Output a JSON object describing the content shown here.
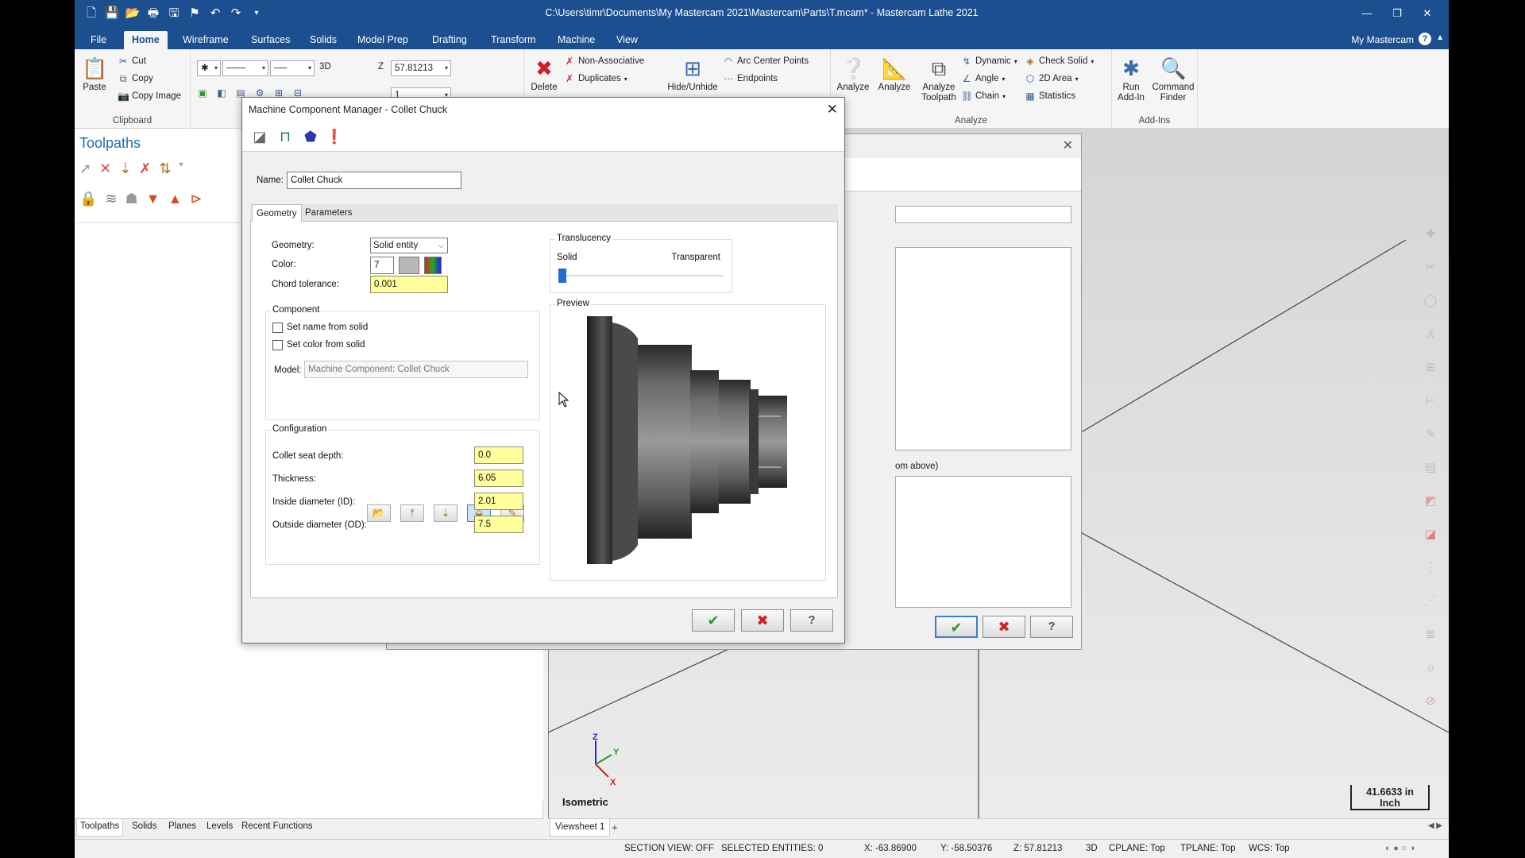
{
  "window": {
    "title": "C:\\Users\\timr\\Documents\\My Mastercam 2021\\Mastercam\\Parts\\T.mcam* - Mastercam Lathe 2021",
    "my_mastercam": "My Mastercam"
  },
  "menu": {
    "tabs": [
      "File",
      "Home",
      "Wireframe",
      "Surfaces",
      "Solids",
      "Model Prep",
      "Drafting",
      "Transform",
      "Machine",
      "View"
    ],
    "active": "Home"
  },
  "ribbon": {
    "clipboard": {
      "paste": "Paste",
      "cut": "Cut",
      "copy": "Copy",
      "copy_image": "Copy Image",
      "label": "Clipboard"
    },
    "attributes": {
      "view_3d": "3D",
      "z_label": "Z",
      "z_value": "57.81213",
      "level_value": "1"
    },
    "organize": {
      "delete": "Delete",
      "non_associative": "Non-Associative",
      "duplicates": "Duplicates",
      "hide_unhide": "Hide/Unhide",
      "arc_center_points": "Arc Center Points",
      "endpoints": "Endpoints"
    },
    "analyze": {
      "analyze1": "Analyze",
      "analyze2": "Analyze",
      "analyze_toolpath_line1": "Analyze",
      "analyze_toolpath_line2": "Toolpath",
      "dynamic": "Dynamic",
      "angle": "Angle",
      "chain": "Chain",
      "check_solid": "Check Solid",
      "area_2d": "2D Area",
      "statistics": "Statistics",
      "label": "Analyze"
    },
    "addins": {
      "run_addin_line1": "Run",
      "run_addin_line2": "Add-In",
      "command_finder_line1": "Command",
      "command_finder_line2": "Finder",
      "label": "Add-Ins"
    }
  },
  "left_panel": {
    "title": "Toolpaths",
    "bottom_tabs": [
      "Toolpaths",
      "Solids",
      "Planes",
      "Levels",
      "Recent Functions"
    ],
    "active_tab": "Toolpaths"
  },
  "viewport": {
    "view_name": "Isometric",
    "scale_value": "41.6633 in",
    "scale_unit": "Inch",
    "sheet_tab": "Viewsheet 1",
    "axis": {
      "z": "Z",
      "y": "Y",
      "x": "X"
    }
  },
  "status_bar": {
    "section_view": "SECTION VIEW: OFF",
    "selected_entities": "SELECTED ENTITIES: 0",
    "x": "X:   -63.86900",
    "y": "Y:   -58.50376",
    "z": "Z:   57.81213",
    "mode": "3D",
    "cplane": "CPLANE: Top",
    "tplane": "TPLANE: Top",
    "wcs": "WCS: Top"
  },
  "background_dialog": {
    "partial_text": "om above)"
  },
  "dialog": {
    "title": "Machine Component Manager - Collet Chuck",
    "name_label": "Name:",
    "name_value": "Collet Chuck",
    "tabs": [
      "Geometry",
      "Parameters"
    ],
    "active_tab": "Geometry",
    "geometry_label": "Geometry:",
    "geometry_value": "Solid entity",
    "color_label": "Color:",
    "color_value": "7",
    "chord_label": "Chord tolerance:",
    "chord_value": "0.001",
    "component": {
      "title": "Component",
      "set_name": "Set name from solid",
      "set_color": "Set color from solid",
      "set_name_checked": false,
      "set_color_checked": false,
      "model_label": "Model:",
      "model_value": "Machine Component: Collet Chuck"
    },
    "configuration": {
      "title": "Configuration",
      "fields": [
        {
          "label": "Collet seat depth:",
          "value": "0.0"
        },
        {
          "label": "Thickness:",
          "value": "6.05"
        },
        {
          "label": "Inside diameter (ID):",
          "value": "2.01"
        },
        {
          "label": "Outside diameter (OD):",
          "value": "7.5"
        }
      ]
    },
    "translucency": {
      "title": "Translucency",
      "solid": "Solid",
      "transparent": "Transparent",
      "level": 0
    },
    "preview_title": "Preview"
  },
  "colors": {
    "title_bar": "#1b4f8f",
    "highlight_field": "#ffff9e",
    "ok_green": "#2e9a2e",
    "cancel_red": "#d22020",
    "panel_title_blue": "#1b6fb8"
  }
}
